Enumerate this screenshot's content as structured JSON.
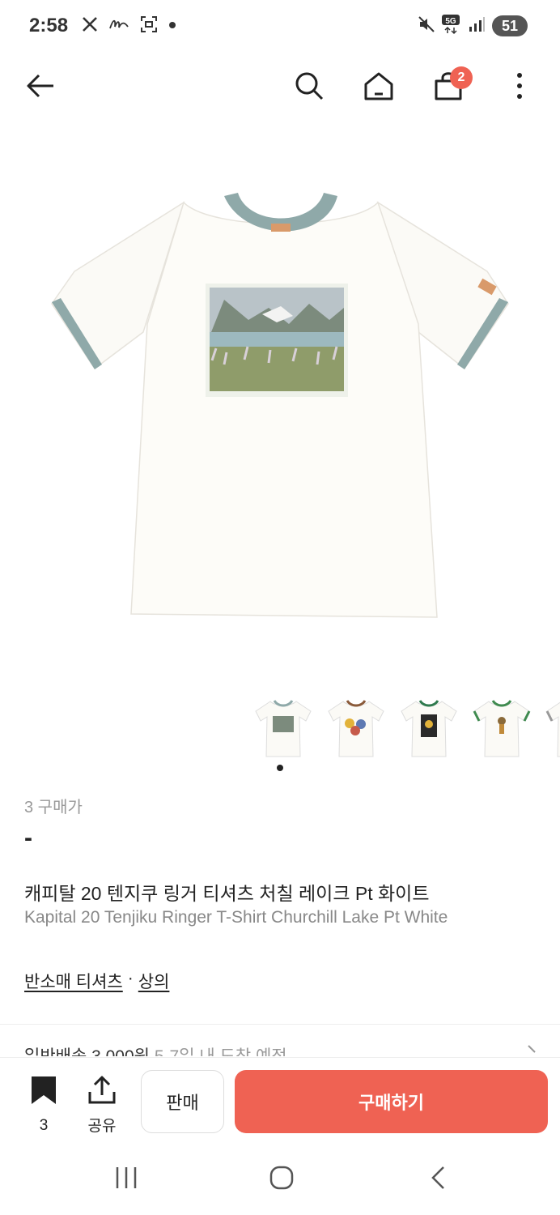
{
  "status_bar": {
    "time": "2:58",
    "left_icons": [
      "x-logo-icon",
      "app-logo-icon",
      "screenshot-icon",
      "dot-icon"
    ],
    "network": "5G",
    "battery": "51"
  },
  "header": {
    "cart_count": "2",
    "icons": [
      "back-arrow-icon",
      "search-icon",
      "home-icon",
      "shopping-bag-icon",
      "more-vertical-icon"
    ]
  },
  "product": {
    "buyer_count": "3 구매가",
    "price": "-",
    "name_ko": "캐피탈 20 텐지쿠 링거 티셔츠 처칠 레이크 Pt 화이트",
    "name_en": "Kapital 20 Tenjiku Ringer T-Shirt Churchill Lake Pt White",
    "category_main": "반소매 티셔츠",
    "category_separator": "·",
    "category_sub": "상의",
    "thumbnail_trims": [
      "#8fa9a9",
      "#8a5a3a",
      "#2f7a4e",
      "#3f8a4f",
      "#999999"
    ]
  },
  "shipping": {
    "label": "일반배송 3,000원",
    "eta": "5-7일 내 도착 예정"
  },
  "action_bar": {
    "bookmark_count": "3",
    "share_label": "공유",
    "sell_label": "판매",
    "buy_label": "구매하기",
    "accent": "#ef6253"
  }
}
